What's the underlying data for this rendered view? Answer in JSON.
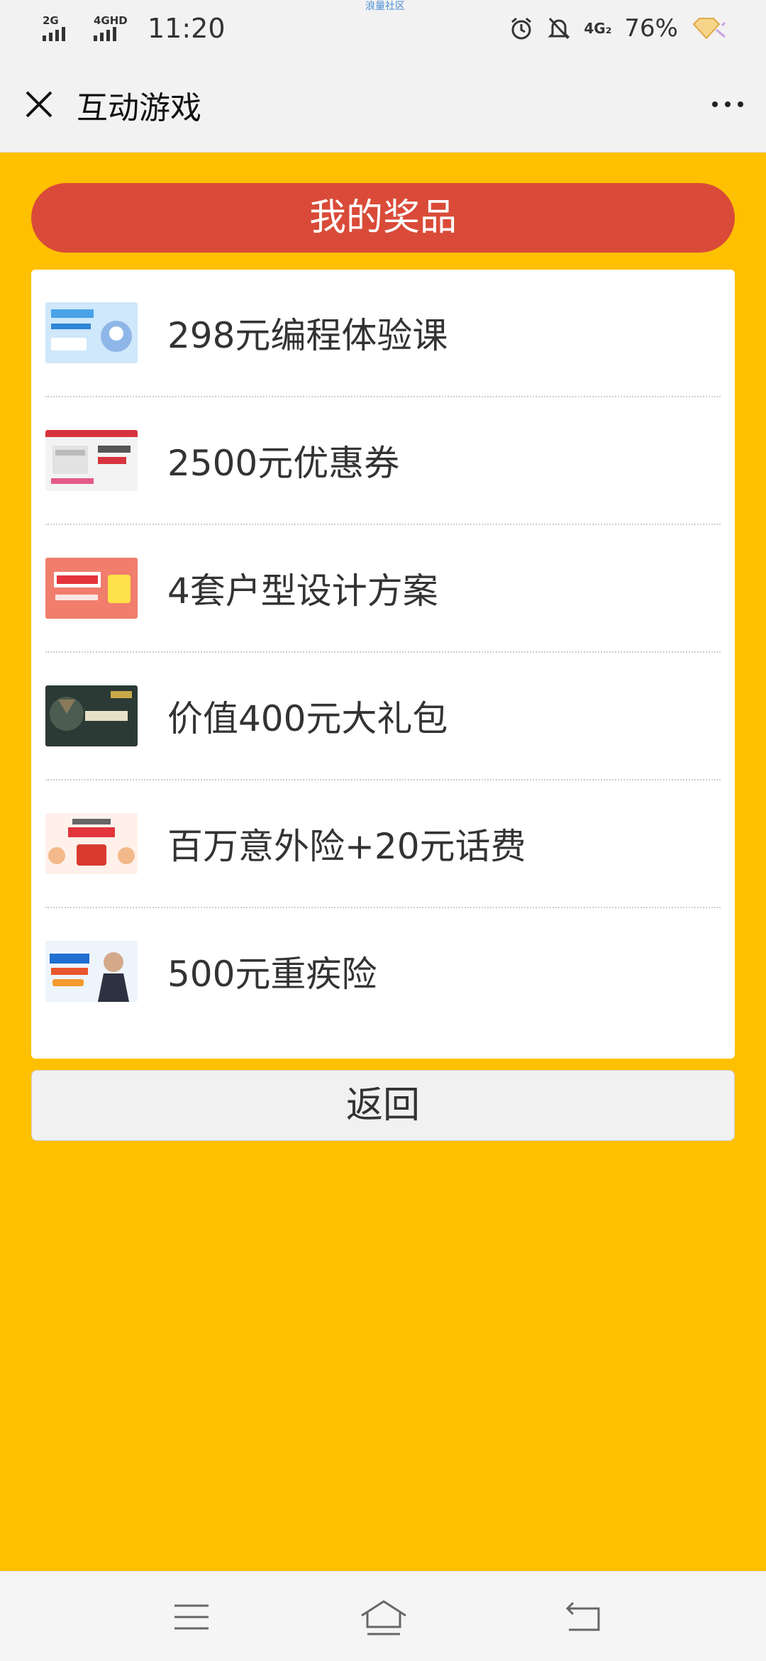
{
  "status_bar": {
    "top_text": "浪量社区",
    "net1": "2G",
    "net2": "4GHD",
    "time": "11:20",
    "net4g": "4G₂",
    "battery": "76%",
    "icons": [
      "alarm-icon",
      "bell-muted-icon",
      "diamond-icon"
    ]
  },
  "title_bar": {
    "title": "互动游戏",
    "close_icon": "close-icon",
    "more_icon": "more-icon"
  },
  "main": {
    "header": "我的奖品",
    "prizes": [
      {
        "name": "298元编程体验课",
        "thumb": "programming-course-thumbnail"
      },
      {
        "name": "2500元优惠券",
        "thumb": "coupon-thumbnail"
      },
      {
        "name": "4套户型设计方案",
        "thumb": "decoration-design-thumbnail"
      },
      {
        "name": "价值400元大礼包",
        "thumb": "game-gift-thumbnail"
      },
      {
        "name": "百万意外险+20元话费",
        "thumb": "insurance-phone-credit-thumbnail"
      },
      {
        "name": "500元重疾险",
        "thumb": "critical-illness-insurance-thumbnail"
      }
    ],
    "back_label": "返回"
  },
  "nav_bar": {
    "icons": [
      "menu-icon",
      "home-icon",
      "back-icon"
    ]
  },
  "colors": {
    "background": "#ffc000",
    "header": "#d94b38",
    "card": "#ffffff"
  }
}
